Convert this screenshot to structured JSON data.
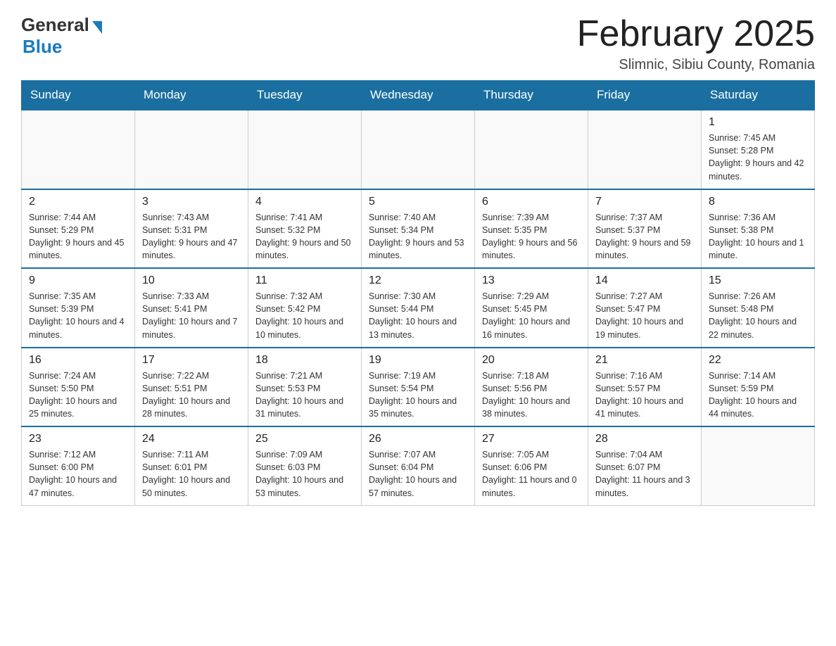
{
  "header": {
    "logo_general": "General",
    "logo_blue": "Blue",
    "month_title": "February 2025",
    "location": "Slimnic, Sibiu County, Romania"
  },
  "weekdays": [
    "Sunday",
    "Monday",
    "Tuesday",
    "Wednesday",
    "Thursday",
    "Friday",
    "Saturday"
  ],
  "weeks": [
    [
      {
        "day": "",
        "info": ""
      },
      {
        "day": "",
        "info": ""
      },
      {
        "day": "",
        "info": ""
      },
      {
        "day": "",
        "info": ""
      },
      {
        "day": "",
        "info": ""
      },
      {
        "day": "",
        "info": ""
      },
      {
        "day": "1",
        "info": "Sunrise: 7:45 AM\nSunset: 5:28 PM\nDaylight: 9 hours and 42 minutes."
      }
    ],
    [
      {
        "day": "2",
        "info": "Sunrise: 7:44 AM\nSunset: 5:29 PM\nDaylight: 9 hours and 45 minutes."
      },
      {
        "day": "3",
        "info": "Sunrise: 7:43 AM\nSunset: 5:31 PM\nDaylight: 9 hours and 47 minutes."
      },
      {
        "day": "4",
        "info": "Sunrise: 7:41 AM\nSunset: 5:32 PM\nDaylight: 9 hours and 50 minutes."
      },
      {
        "day": "5",
        "info": "Sunrise: 7:40 AM\nSunset: 5:34 PM\nDaylight: 9 hours and 53 minutes."
      },
      {
        "day": "6",
        "info": "Sunrise: 7:39 AM\nSunset: 5:35 PM\nDaylight: 9 hours and 56 minutes."
      },
      {
        "day": "7",
        "info": "Sunrise: 7:37 AM\nSunset: 5:37 PM\nDaylight: 9 hours and 59 minutes."
      },
      {
        "day": "8",
        "info": "Sunrise: 7:36 AM\nSunset: 5:38 PM\nDaylight: 10 hours and 1 minute."
      }
    ],
    [
      {
        "day": "9",
        "info": "Sunrise: 7:35 AM\nSunset: 5:39 PM\nDaylight: 10 hours and 4 minutes."
      },
      {
        "day": "10",
        "info": "Sunrise: 7:33 AM\nSunset: 5:41 PM\nDaylight: 10 hours and 7 minutes."
      },
      {
        "day": "11",
        "info": "Sunrise: 7:32 AM\nSunset: 5:42 PM\nDaylight: 10 hours and 10 minutes."
      },
      {
        "day": "12",
        "info": "Sunrise: 7:30 AM\nSunset: 5:44 PM\nDaylight: 10 hours and 13 minutes."
      },
      {
        "day": "13",
        "info": "Sunrise: 7:29 AM\nSunset: 5:45 PM\nDaylight: 10 hours and 16 minutes."
      },
      {
        "day": "14",
        "info": "Sunrise: 7:27 AM\nSunset: 5:47 PM\nDaylight: 10 hours and 19 minutes."
      },
      {
        "day": "15",
        "info": "Sunrise: 7:26 AM\nSunset: 5:48 PM\nDaylight: 10 hours and 22 minutes."
      }
    ],
    [
      {
        "day": "16",
        "info": "Sunrise: 7:24 AM\nSunset: 5:50 PM\nDaylight: 10 hours and 25 minutes."
      },
      {
        "day": "17",
        "info": "Sunrise: 7:22 AM\nSunset: 5:51 PM\nDaylight: 10 hours and 28 minutes."
      },
      {
        "day": "18",
        "info": "Sunrise: 7:21 AM\nSunset: 5:53 PM\nDaylight: 10 hours and 31 minutes."
      },
      {
        "day": "19",
        "info": "Sunrise: 7:19 AM\nSunset: 5:54 PM\nDaylight: 10 hours and 35 minutes."
      },
      {
        "day": "20",
        "info": "Sunrise: 7:18 AM\nSunset: 5:56 PM\nDaylight: 10 hours and 38 minutes."
      },
      {
        "day": "21",
        "info": "Sunrise: 7:16 AM\nSunset: 5:57 PM\nDaylight: 10 hours and 41 minutes."
      },
      {
        "day": "22",
        "info": "Sunrise: 7:14 AM\nSunset: 5:59 PM\nDaylight: 10 hours and 44 minutes."
      }
    ],
    [
      {
        "day": "23",
        "info": "Sunrise: 7:12 AM\nSunset: 6:00 PM\nDaylight: 10 hours and 47 minutes."
      },
      {
        "day": "24",
        "info": "Sunrise: 7:11 AM\nSunset: 6:01 PM\nDaylight: 10 hours and 50 minutes."
      },
      {
        "day": "25",
        "info": "Sunrise: 7:09 AM\nSunset: 6:03 PM\nDaylight: 10 hours and 53 minutes."
      },
      {
        "day": "26",
        "info": "Sunrise: 7:07 AM\nSunset: 6:04 PM\nDaylight: 10 hours and 57 minutes."
      },
      {
        "day": "27",
        "info": "Sunrise: 7:05 AM\nSunset: 6:06 PM\nDaylight: 11 hours and 0 minutes."
      },
      {
        "day": "28",
        "info": "Sunrise: 7:04 AM\nSunset: 6:07 PM\nDaylight: 11 hours and 3 minutes."
      },
      {
        "day": "",
        "info": ""
      }
    ]
  ]
}
